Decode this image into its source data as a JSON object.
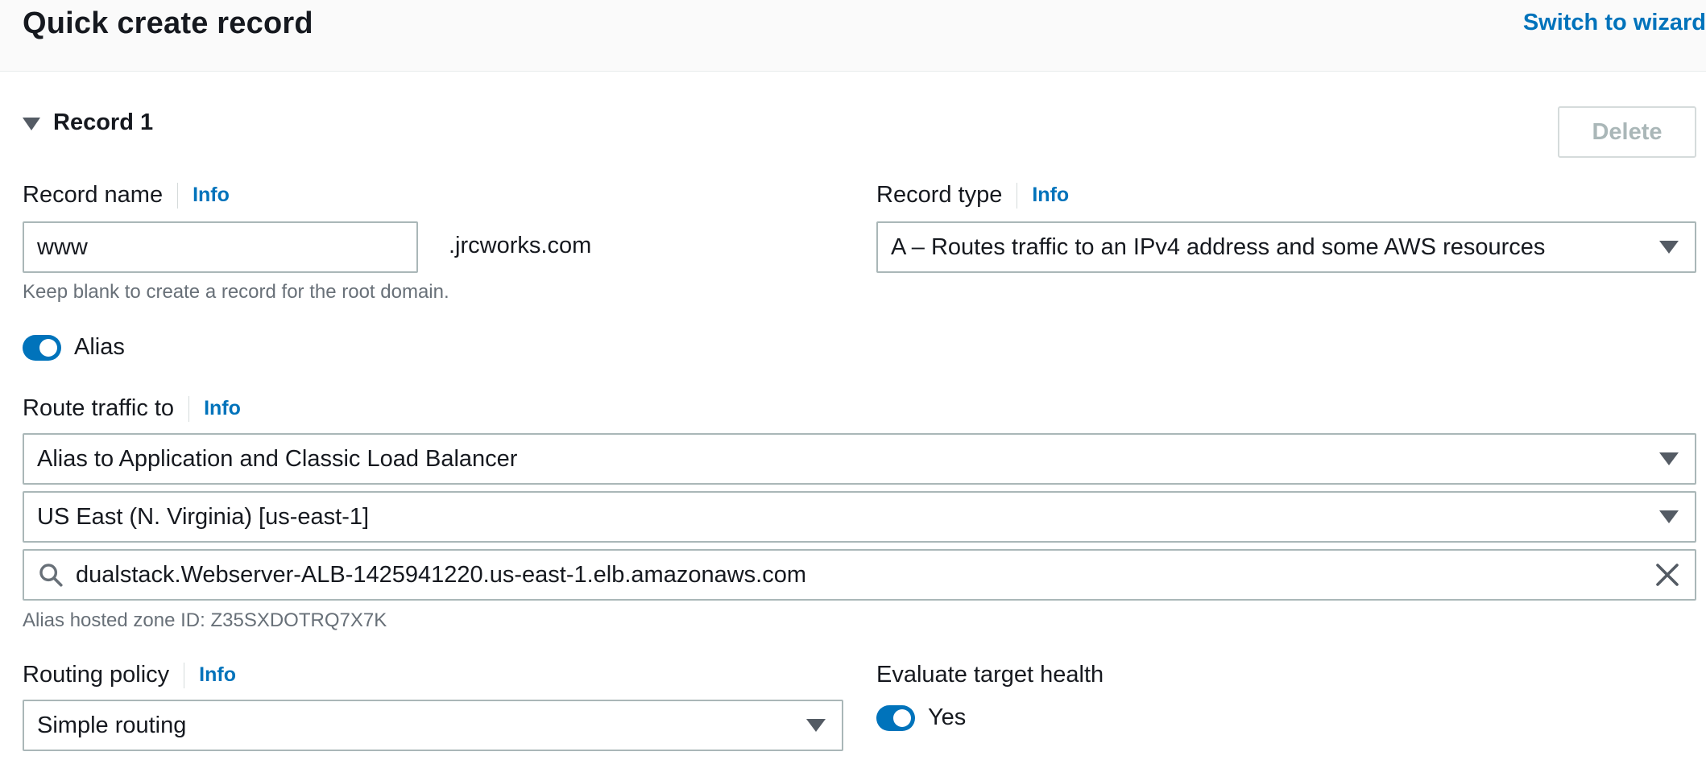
{
  "header": {
    "title": "Quick create record",
    "switch_link": "Switch to wizard"
  },
  "record": {
    "title": "Record 1",
    "delete_label": "Delete",
    "info_label": "Info",
    "name": {
      "label": "Record name",
      "value": "www",
      "suffix": ".jrcworks.com",
      "hint": "Keep blank to create a record for the root domain."
    },
    "type": {
      "label": "Record type",
      "value": "A – Routes traffic to an IPv4 address and some AWS resources"
    },
    "alias": {
      "label": "Alias",
      "enabled": true
    },
    "route_traffic": {
      "label": "Route traffic to",
      "endpoint": "Alias to Application and Classic Load Balancer",
      "region": "US East (N. Virginia) [us-east-1]",
      "load_balancer": "dualstack.Webserver-ALB-1425941220.us-east-1.elb.amazonaws.com",
      "hosted_zone": "Alias hosted zone ID: Z35SXDOTRQ7X7K"
    },
    "routing_policy": {
      "label": "Routing policy",
      "value": "Simple routing"
    },
    "evaluate_health": {
      "label": "Evaluate target health",
      "toggle_label": "Yes",
      "enabled": true
    }
  },
  "colors": {
    "accent": "#0073bb",
    "header_bg": "#fafafa",
    "border": "#aab7b8",
    "hint_text": "#687078"
  },
  "icons": [
    "caret-down-icon",
    "dropdown-arrow-icon",
    "search-icon",
    "clear-icon",
    "toggle-icon"
  ]
}
